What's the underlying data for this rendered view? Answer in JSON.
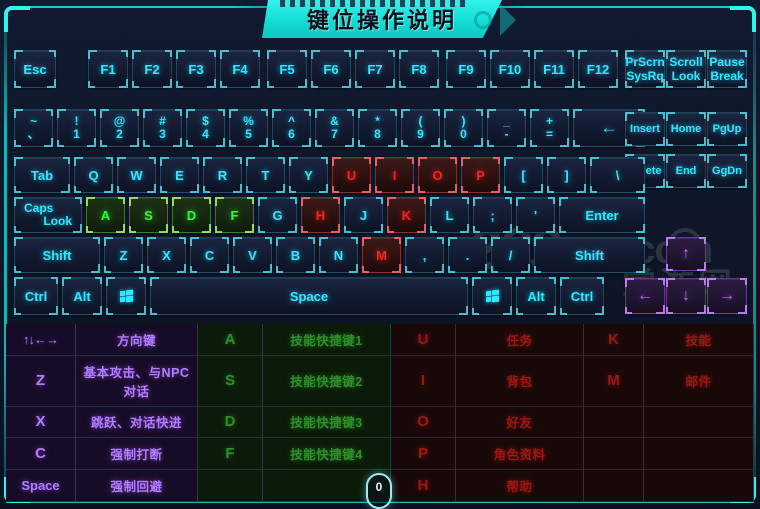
{
  "title": "键位操作说明",
  "watermark": {
    "brand": "289",
    "tld": ".com",
    "cn": "掌游网"
  },
  "mouse_badge": "0",
  "keyboard": {
    "rows": {
      "function_row": [
        {
          "id": "esc",
          "label": "Esc"
        },
        {
          "id": "f1",
          "label": "F1"
        },
        {
          "id": "f2",
          "label": "F2"
        },
        {
          "id": "f3",
          "label": "F3"
        },
        {
          "id": "f4",
          "label": "F4"
        },
        {
          "id": "f5",
          "label": "F5"
        },
        {
          "id": "f6",
          "label": "F6"
        },
        {
          "id": "f7",
          "label": "F7"
        },
        {
          "id": "f8",
          "label": "F8"
        },
        {
          "id": "f9",
          "label": "F9"
        },
        {
          "id": "f10",
          "label": "F10"
        },
        {
          "id": "f11",
          "label": "F11"
        },
        {
          "id": "f12",
          "label": "F12"
        }
      ],
      "number_row": [
        {
          "id": "backquote",
          "top": "~",
          "bottom": "、"
        },
        {
          "id": "digit1",
          "top": "!",
          "bottom": "1"
        },
        {
          "id": "digit2",
          "top": "@",
          "bottom": "2"
        },
        {
          "id": "digit3",
          "top": "#",
          "bottom": "3"
        },
        {
          "id": "digit4",
          "top": "$",
          "bottom": "4"
        },
        {
          "id": "digit5",
          "top": "%",
          "bottom": "5"
        },
        {
          "id": "digit6",
          "top": "^",
          "bottom": "6"
        },
        {
          "id": "digit7",
          "top": "&",
          "bottom": "7"
        },
        {
          "id": "digit8",
          "top": "*",
          "bottom": "8"
        },
        {
          "id": "digit9",
          "top": "(",
          "bottom": "9"
        },
        {
          "id": "digit0",
          "top": ")",
          "bottom": "0"
        },
        {
          "id": "minus",
          "top": "_",
          "bottom": "-"
        },
        {
          "id": "equal",
          "top": "+",
          "bottom": "="
        },
        {
          "id": "backspace",
          "label": "←"
        }
      ],
      "tab_row": [
        {
          "id": "tab",
          "label": "Tab"
        },
        {
          "id": "q",
          "label": "Q"
        },
        {
          "id": "w",
          "label": "W"
        },
        {
          "id": "e",
          "label": "E"
        },
        {
          "id": "r",
          "label": "R"
        },
        {
          "id": "t",
          "label": "T"
        },
        {
          "id": "y",
          "label": "Y"
        },
        {
          "id": "u",
          "label": "U",
          "state": "red"
        },
        {
          "id": "i",
          "label": "I",
          "state": "red"
        },
        {
          "id": "o",
          "label": "O",
          "state": "red"
        },
        {
          "id": "p",
          "label": "P",
          "state": "red"
        },
        {
          "id": "bracketleft",
          "label": "["
        },
        {
          "id": "bracketright",
          "label": "]"
        },
        {
          "id": "backslash",
          "label": "\\"
        }
      ],
      "caps_row": [
        {
          "id": "capslock",
          "line1": "Caps",
          "line2": "Look"
        },
        {
          "id": "a",
          "label": "A",
          "state": "green"
        },
        {
          "id": "s",
          "label": "S",
          "state": "green"
        },
        {
          "id": "d",
          "label": "D",
          "state": "green"
        },
        {
          "id": "f",
          "label": "F",
          "state": "green"
        },
        {
          "id": "g",
          "label": "G"
        },
        {
          "id": "h",
          "label": "H",
          "state": "red"
        },
        {
          "id": "j",
          "label": "J"
        },
        {
          "id": "k",
          "label": "K",
          "state": "red"
        },
        {
          "id": "l",
          "label": "L"
        },
        {
          "id": "semicolon",
          "label": ";"
        },
        {
          "id": "quote",
          "label": "'"
        },
        {
          "id": "enter",
          "label": "Enter"
        }
      ],
      "shift_row": [
        {
          "id": "shiftleft",
          "label": "Shift"
        },
        {
          "id": "z",
          "label": "Z"
        },
        {
          "id": "x",
          "label": "X"
        },
        {
          "id": "c",
          "label": "C"
        },
        {
          "id": "v",
          "label": "V"
        },
        {
          "id": "b",
          "label": "B"
        },
        {
          "id": "n",
          "label": "N"
        },
        {
          "id": "m",
          "label": "M",
          "state": "red"
        },
        {
          "id": "comma",
          "label": ","
        },
        {
          "id": "period",
          "label": "."
        },
        {
          "id": "slash",
          "label": "/"
        },
        {
          "id": "shiftright",
          "label": "Shift"
        }
      ],
      "bottom_row": [
        {
          "id": "ctrlleft",
          "label": "Ctrl"
        },
        {
          "id": "altleft",
          "label": "Alt"
        },
        {
          "id": "winleft",
          "label": "",
          "icon": "windows-icon"
        },
        {
          "id": "space",
          "label": "Space"
        },
        {
          "id": "winright",
          "label": "",
          "icon": "windows-icon"
        },
        {
          "id": "altright",
          "label": "Alt"
        },
        {
          "id": "ctrlright",
          "label": "Ctrl"
        }
      ]
    },
    "nav_cluster": {
      "top": [
        {
          "id": "printscreen",
          "line1": "PrScrn",
          "line2": "SysRq"
        },
        {
          "id": "scrolllock",
          "line1": "Scroll",
          "line2": "Look"
        },
        {
          "id": "pausebreak",
          "line1": "Pause",
          "line2": "Break"
        }
      ],
      "middle": [
        {
          "id": "insert",
          "label": "Insert"
        },
        {
          "id": "home",
          "label": "Home"
        },
        {
          "id": "pageup",
          "label": "PgUp"
        },
        {
          "id": "delete",
          "label": "Delete"
        },
        {
          "id": "end",
          "label": "End"
        },
        {
          "id": "pagedown",
          "label": "GgDn"
        }
      ],
      "arrows": [
        {
          "id": "arrowup",
          "label": "↑",
          "state": "purple"
        },
        {
          "id": "arrowleft",
          "label": "←",
          "state": "purple"
        },
        {
          "id": "arrowdown",
          "label": "↓",
          "state": "purple"
        },
        {
          "id": "arrowright",
          "label": "→",
          "state": "purple"
        }
      ]
    }
  },
  "legend": {
    "rows": [
      {
        "move_key": "↑↓←→",
        "move_desc": "方向键",
        "skill_key": "A",
        "skill_desc": "技能快捷键1",
        "ui_key": "U",
        "ui_desc": "任务",
        "ui2_key": "K",
        "ui2_desc": "技能"
      },
      {
        "move_key": "Z",
        "move_desc": "基本攻击、与NPC对话",
        "skill_key": "S",
        "skill_desc": "技能快捷键2",
        "ui_key": "I",
        "ui_desc": "背包",
        "ui2_key": "M",
        "ui2_desc": "邮件"
      },
      {
        "move_key": "X",
        "move_desc": "跳跃、对话快进",
        "skill_key": "D",
        "skill_desc": "技能快捷键3",
        "ui_key": "O",
        "ui_desc": "好友",
        "ui2_key": "",
        "ui2_desc": ""
      },
      {
        "move_key": "C",
        "move_desc": "强制打断",
        "skill_key": "F",
        "skill_desc": "技能快捷键4",
        "ui_key": "P",
        "ui_desc": "角色资料",
        "ui2_key": "",
        "ui2_desc": ""
      },
      {
        "move_key": "Space",
        "move_desc": "强制回避",
        "skill_key": "",
        "skill_desc": "",
        "ui_key": "H",
        "ui_desc": "帮助",
        "ui2_key": "",
        "ui2_desc": ""
      }
    ]
  },
  "colors": {
    "accent_cyan": "#2ff5ea",
    "key_cyan": "#32e8ff",
    "highlight_red": "#ff2020",
    "highlight_green": "#2bff37",
    "highlight_purple": "#c86bff",
    "background": "#0d1326"
  }
}
